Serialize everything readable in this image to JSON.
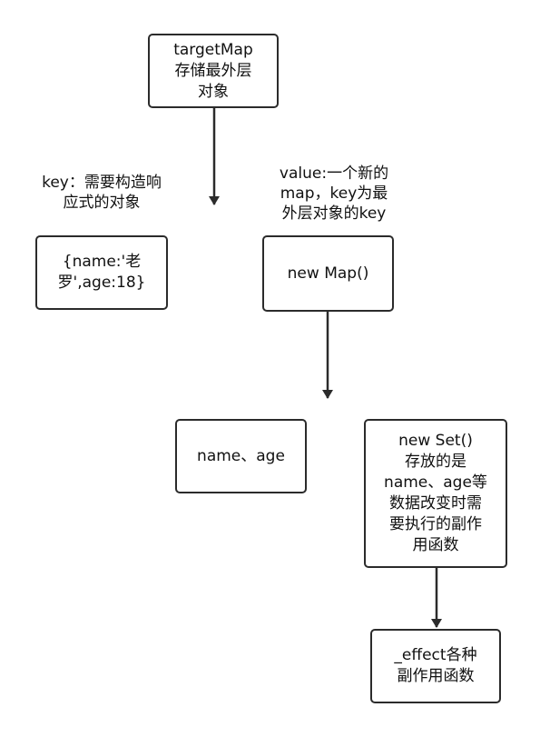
{
  "nodes": {
    "target_map": {
      "lines": [
        "targetMap",
        "存储最外层",
        "对象"
      ]
    },
    "raw_object": {
      "lines": [
        "{name:'老",
        "罗',age:18}"
      ]
    },
    "new_map": {
      "lines": [
        "new Map()"
      ]
    },
    "keys": {
      "lines": [
        "name、age"
      ]
    },
    "new_set": {
      "lines": [
        "new Set()",
        "存放的是",
        "name、age等",
        "数据改变时需",
        "要执行的副作",
        "用函数"
      ]
    },
    "effect": {
      "lines": [
        "_effect各种",
        "副作用函数"
      ]
    }
  },
  "labels": {
    "key_label": {
      "lines": [
        "key：需要构造响",
        "应式的对象"
      ]
    },
    "value_label": {
      "lines": [
        "value:一个新的",
        "map，key为最",
        "外层对象的key"
      ]
    }
  }
}
